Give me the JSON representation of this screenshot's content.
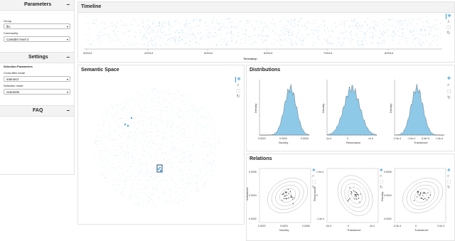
{
  "sidebar": {
    "parameters": {
      "title": "Parameters",
      "collapse_icon": "minus-icon",
      "group_label": "Group",
      "group_value": "lbc",
      "community_label": "Community",
      "community_value": "Cantabri Insel 2"
    },
    "settings": {
      "title": "Settings",
      "section_label": "Selection Parameters",
      "cross_filter_label": "Cross filter mode",
      "cross_filter_value": "intersect",
      "selection_mode_label": "Selection mode",
      "selection_mode_value": "overwrite"
    },
    "faq": {
      "title": "FAQ"
    }
  },
  "timeline": {
    "title": "Timeline",
    "xlabel": "Timestamp",
    "ticks": [
      "3/2014",
      "4/2014",
      "5/2014",
      "6/2014",
      "7/2014",
      "8/2014"
    ]
  },
  "semantic": {
    "title": "Semantic Space"
  },
  "distributions": {
    "title": "Distributions",
    "plots": [
      {
        "xlabel": "Novelty",
        "ylabel": "Density",
        "ticks": [
          "0.0022",
          "0.0024",
          "0.0026"
        ]
      },
      {
        "xlabel": "Resonance",
        "ylabel": "Density",
        "ticks": [
          "-1e-4",
          "0",
          "1e-4"
        ]
      },
      {
        "xlabel": "Transience",
        "ylabel": "Density",
        "ticks": [
          "-2.0e-4",
          "-1.0e-4",
          "0.0e+0",
          "1.0e-4"
        ]
      }
    ]
  },
  "relations": {
    "title": "Relations",
    "plots": [
      {
        "xlabel": "Novelty",
        "ylabel": "Transience",
        "xticks": [
          "0.0022",
          "0.0024",
          "0.0026"
        ],
        "yticks": [
          "0.0026",
          "0.0024",
          "0.0022"
        ]
      },
      {
        "xlabel": "Transience",
        "ylabel": "Resonance",
        "xticks": [
          "-2e-4",
          "0",
          "2e-4"
        ],
        "yticks": [
          "1.0e-4",
          "0",
          "-1.0e-4"
        ]
      },
      {
        "xlabel": "Transience",
        "ylabel": "Density",
        "xticks": [
          "-2.0e-4",
          "0",
          "2.0e-4"
        ],
        "yticks": [
          "0.0026",
          "0.0024",
          "0.0022"
        ]
      }
    ]
  },
  "toolbar_icons": [
    "pan-icon",
    "zoom-icon",
    "box-select-icon",
    "reset-icon"
  ],
  "colors": {
    "accent": "#3b9ad9",
    "points": "#4aa3df",
    "density": "#8ec9e8"
  }
}
